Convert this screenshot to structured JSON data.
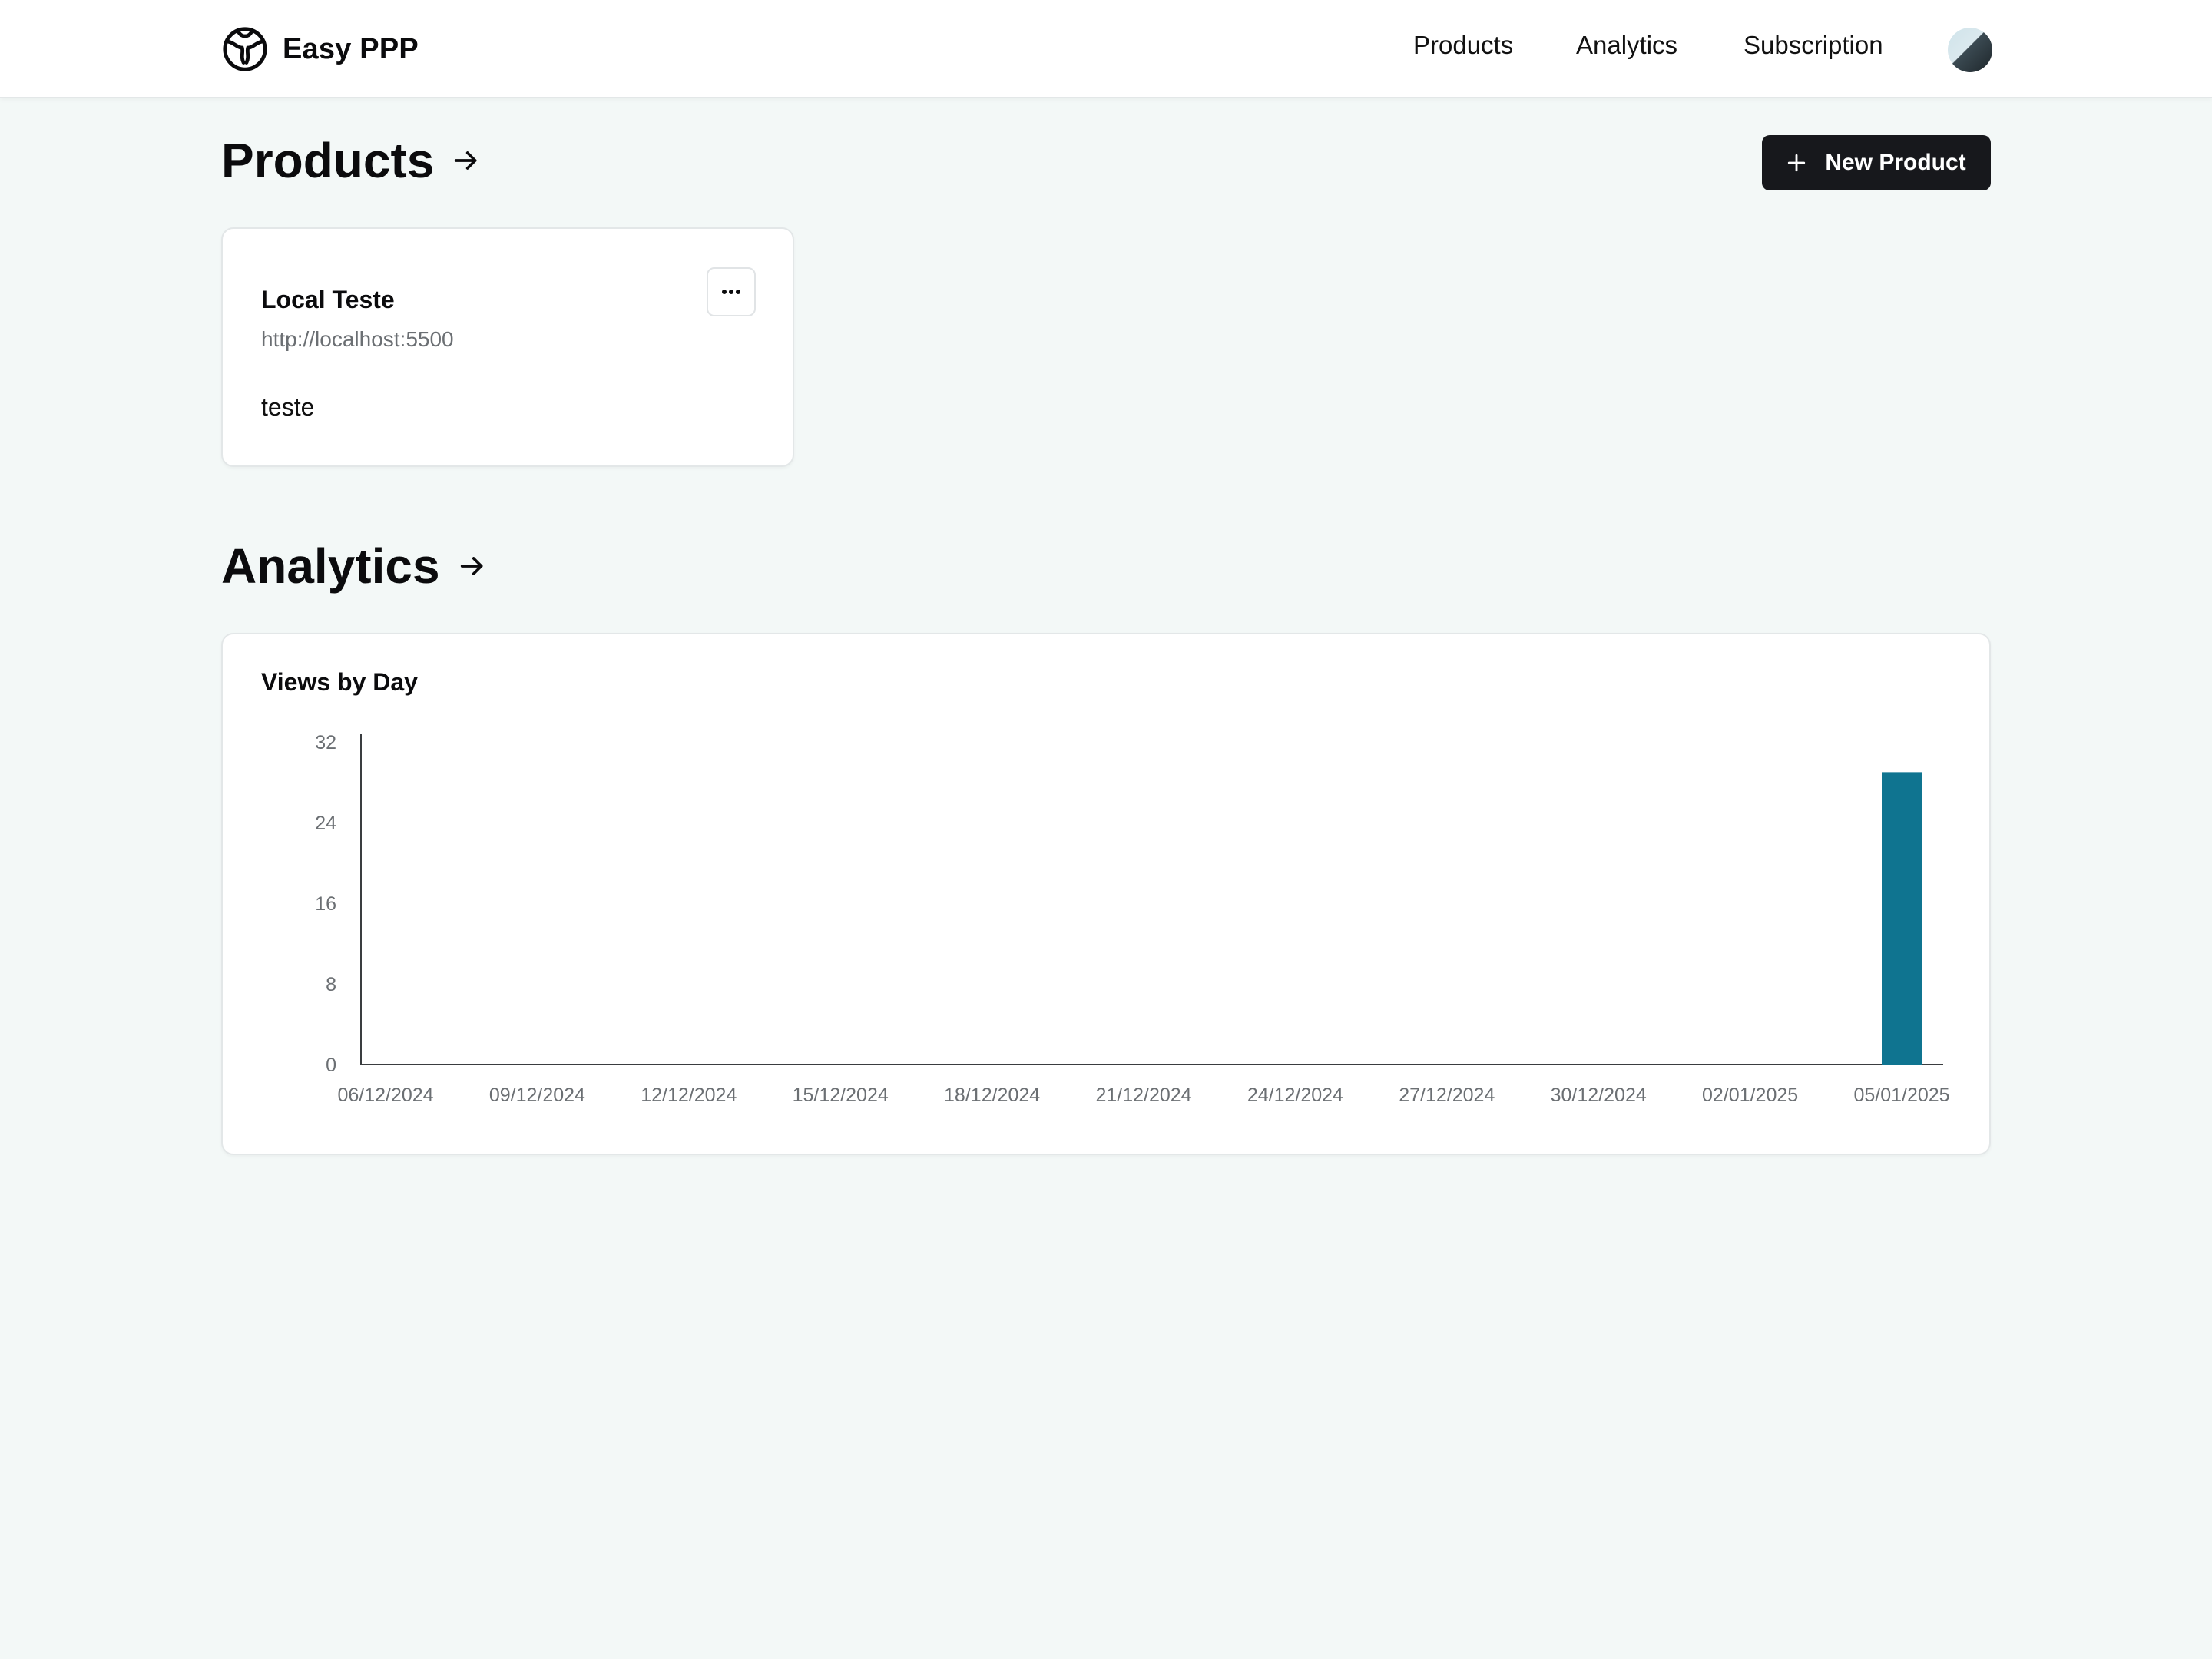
{
  "header": {
    "brand": "Easy PPP",
    "nav": [
      "Products",
      "Analytics",
      "Subscription"
    ]
  },
  "products_section": {
    "title": "Products",
    "new_button": "New Product",
    "items": [
      {
        "name": "Local Teste",
        "url": "http://localhost:5500",
        "description": "teste"
      }
    ]
  },
  "analytics_section": {
    "title": "Analytics"
  },
  "colors": {
    "accent_bar": "#0f7490",
    "button_dark": "#17181c",
    "background": "#f3f8f7"
  },
  "chart_data": {
    "type": "bar",
    "title": "Views by Day",
    "xlabel": "",
    "ylabel": "",
    "ylim": [
      0,
      32
    ],
    "yticks": [
      0,
      8,
      16,
      24,
      32
    ],
    "x_tick_labels": [
      "06/12/2024",
      "09/12/2024",
      "12/12/2024",
      "15/12/2024",
      "18/12/2024",
      "21/12/2024",
      "24/12/2024",
      "27/12/2024",
      "30/12/2024",
      "02/01/2025",
      "05/01/2025"
    ],
    "categories": [
      "05/01/2025"
    ],
    "values": [
      29
    ],
    "grid": false,
    "color": "#0f7490"
  }
}
